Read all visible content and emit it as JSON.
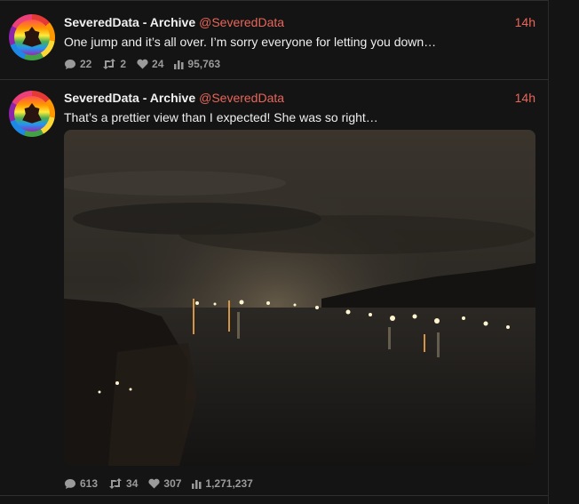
{
  "tweets": [
    {
      "author_name": "SeveredData - Archive",
      "author_handle": "@SeveredData",
      "time": "14h",
      "text": "One jump and it’s all over. I’m sorry everyone for letting you down…",
      "replies": "22",
      "retweets": "2",
      "likes": "24",
      "views": "95,763"
    },
    {
      "author_name": "SeveredData - Archive",
      "author_handle": "@SeveredData",
      "time": "14h",
      "text": "That’s a prettier view than I expected! She was so right…",
      "replies": "613",
      "retweets": "34",
      "likes": "307",
      "views": "1,271,237"
    }
  ],
  "icons": {
    "reply": "speech-bubble-icon",
    "retweet": "retweet-icon",
    "like": "heart-icon",
    "views": "bar-chart-icon",
    "avatar": "rainbow-avatar"
  },
  "colors": {
    "accent": "#e8665a",
    "background": "#141414",
    "text": "#eeeeee",
    "muted": "#9a9a9a"
  }
}
